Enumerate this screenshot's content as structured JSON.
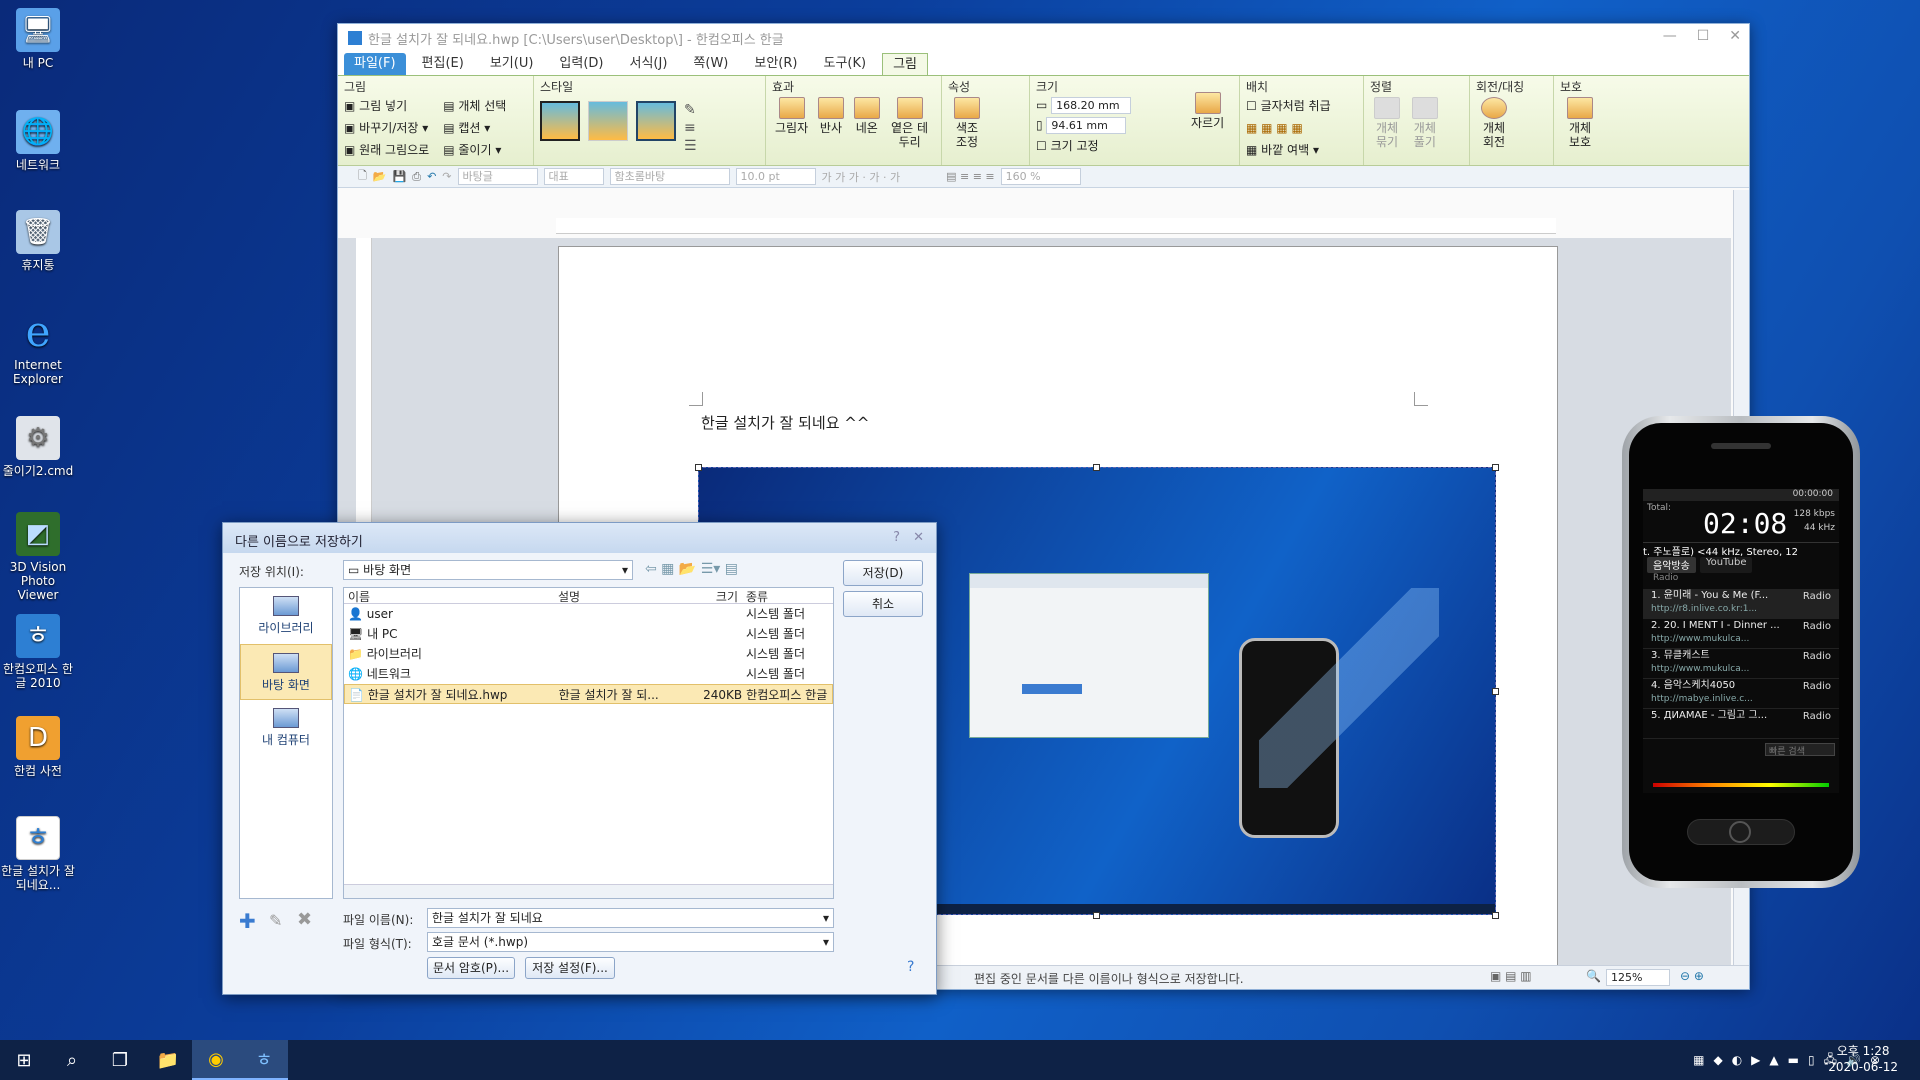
{
  "desktop": {
    "icons": [
      {
        "name": "mypc",
        "label": "내 PC",
        "glyph": "🖥"
      },
      {
        "name": "network",
        "label": "네트워크",
        "glyph": "🌐"
      },
      {
        "name": "recycle",
        "label": "휴지통",
        "glyph": "🗑"
      },
      {
        "name": "ie",
        "label": "Internet Explorer",
        "glyph": "e"
      },
      {
        "name": "cmd",
        "label": "줄이기2.cmd",
        "glyph": "⚙"
      },
      {
        "name": "3dvision",
        "label": "3D Vision Photo Viewer",
        "glyph": "◩"
      },
      {
        "name": "hancom",
        "label": "한컴오피스 한글 2010",
        "glyph": "ㅎ"
      },
      {
        "name": "dict",
        "label": "한컴 사전",
        "glyph": "D"
      },
      {
        "name": "hwpfile",
        "label": "한글 설치가 잘 되네요...",
        "glyph": "ㅎ"
      }
    ]
  },
  "window": {
    "title": "한글 설치가 잘 되네요.hwp [C:\\Users\\user\\Desktop\\] - 한컴오피스 한글",
    "menus": [
      "파일(F)",
      "편집(E)",
      "보기(U)",
      "입력(D)",
      "서식(J)",
      "쪽(W)",
      "보안(R)",
      "도구(K)",
      "그림"
    ],
    "ribbon": {
      "group_picture": {
        "title": "그림",
        "insert": "그림 넣기",
        "replace": "바꾸기/저장",
        "original": "원래 그림으로",
        "select": "개체 선택",
        "caption": "캡션",
        "reduce": "줄이기"
      },
      "group_style": {
        "title": "스타일"
      },
      "group_effect": {
        "title": "효과",
        "shadow": "그림자",
        "reflect": "반사",
        "neon": "네온",
        "soft_edge": "옅은 테두리"
      },
      "group_attr": {
        "title": "속성",
        "color": "색조 조정"
      },
      "group_size": {
        "title": "크기",
        "width": "168.20",
        "height": "94.61",
        "unit": "mm",
        "fix": "크기 고정",
        "crop": "자르기"
      },
      "group_place": {
        "title": "배치",
        "as_char": "글자처럼 취급",
        "margin": "바깥 여백"
      },
      "group_align": {
        "title": "정렬",
        "group": "개체 묶기",
        "ungroup": "개체 풀기"
      },
      "group_rotate": {
        "title": "회전/대칭",
        "rotate": "개체 회전"
      },
      "group_protect": {
        "title": "보호",
        "protect": "개체 보호"
      }
    },
    "format_toolbar": {
      "style": "바탕글",
      "lang": "대표",
      "font": "함초롬바탕",
      "size": "10.0",
      "size_unit": "pt",
      "zoom_line": "160",
      "zoom_unit": "%"
    },
    "document_text": "한글 설치가 잘 되네요 ^^",
    "status": {
      "message": "편집 중인 문서를 다른 이름이나 형식으로 저장합니다.",
      "zoom": "125%"
    }
  },
  "dialog": {
    "title": "다른 이름으로 저장하기",
    "location_label": "저장 위치(I):",
    "location_value": "바탕 화면",
    "save_button": "저장(D)",
    "cancel_button": "취소",
    "places": [
      {
        "label": "라이브러리"
      },
      {
        "label": "바탕 화면"
      },
      {
        "label": "내 컴퓨터"
      }
    ],
    "columns": [
      "이름",
      "설명",
      "크기",
      "종류"
    ],
    "files": [
      {
        "name": "user",
        "desc": "",
        "size": "",
        "type": "시스템 폴더"
      },
      {
        "name": "내 PC",
        "desc": "",
        "size": "",
        "type": "시스템 폴더"
      },
      {
        "name": "라이브러리",
        "desc": "",
        "size": "",
        "type": "시스템 폴더"
      },
      {
        "name": "네트워크",
        "desc": "",
        "size": "",
        "type": "시스템 폴더"
      },
      {
        "name": "한글 설치가 잘 되네요.hwp",
        "desc": "한글 설치가 잘 되...",
        "size": "240KB",
        "type": "한컴오피스 한글"
      }
    ],
    "filename_label": "파일 이름(N):",
    "filename_value": "한글 설치가 잘 되네요",
    "filetype_label": "파일 형식(T):",
    "filetype_value": "호글 문서 (*.hwp)",
    "password_button": "문서 암호(P)...",
    "settings_button": "저장 설정(F)..."
  },
  "phone": {
    "time": "00:00:00",
    "total": "Total:",
    "display_time": "02:08",
    "bitrate": "128 kbps",
    "samplerate": "44 kHz",
    "track": "t. 주노플로) <44 kHz, Stereo, 12",
    "tabs": [
      "음악방송",
      "YouTube"
    ],
    "radio_label": "Radio",
    "stations": [
      {
        "title": "1. 윤미래 - You & Me (F...",
        "url": "http://r8.inlive.co.kr:1...",
        "tag": "Radio"
      },
      {
        "title": "2. 20. I MENT I - Dinner ...",
        "url": "http://www.mukulca...",
        "tag": "Radio"
      },
      {
        "title": "3. 뮤클캐스트",
        "url": "http://www.mukulca...",
        "tag": "Radio"
      },
      {
        "title": "4. 음악스케치4050",
        "url": "http://mabye.inlive.c...",
        "tag": "Radio"
      },
      {
        "title": "5. ДИАМАЕ - 그림고 그...",
        "url": "",
        "tag": "Radio"
      }
    ],
    "search_placeholder": "빠른 검색"
  },
  "taskbar": {
    "clock_time": "오후 1:28",
    "clock_date": "2020-06-12"
  }
}
